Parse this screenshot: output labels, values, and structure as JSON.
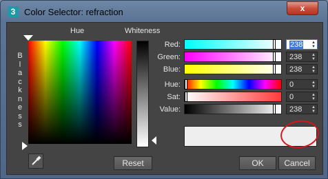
{
  "window": {
    "title": "Color Selector: refraction",
    "app_icon": "3",
    "close_glyph": "x"
  },
  "labels": {
    "hue": "Hue",
    "whiteness": "Whiteness",
    "blackness": "Blackness"
  },
  "rgb": [
    {
      "label": "Red:",
      "value": "238",
      "level": 0.933,
      "active": true
    },
    {
      "label": "Green:",
      "value": "238",
      "level": 0.933
    },
    {
      "label": "Blue:",
      "value": "238",
      "level": 0.933
    }
  ],
  "hsv": [
    {
      "label": "Hue:",
      "value": "0",
      "level": 0
    },
    {
      "label": "Sat:",
      "value": "0",
      "level": 0
    },
    {
      "label": "Value:",
      "value": "238",
      "level": 0.933
    }
  ],
  "colors": {
    "current_color": "#eeeeee",
    "annotation": "#d9141a"
  },
  "buttons": {
    "reset": "Reset",
    "ok": "OK",
    "cancel": "Cancel"
  },
  "icons": {
    "eyedropper": "eyedropper-icon"
  }
}
